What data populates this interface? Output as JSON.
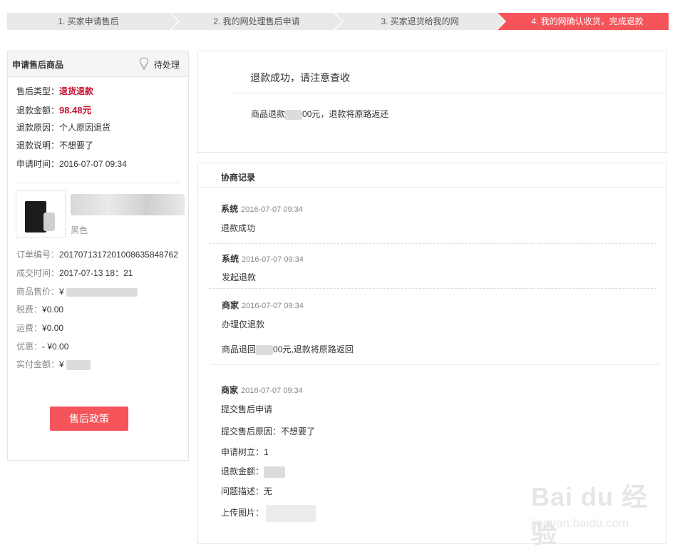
{
  "steps": [
    {
      "label": "1. 买家申请售后"
    },
    {
      "label": "2. 我的网处理售后申请"
    },
    {
      "label": "3. 买家退货给我的网"
    },
    {
      "label": "4. 我的网确认收货，完成退款"
    }
  ],
  "colors": {
    "accent": "#f4545a",
    "price_red": "#c8102e"
  },
  "left_panel": {
    "title": "申请售后商品",
    "status": "待处理",
    "status_icon": "lightbulb-icon",
    "type_label": "售后类型：",
    "type_value": "退货退款",
    "amount_label": "退款金额：",
    "amount_value": "98.48元",
    "reason_label": "退款原因：",
    "reason_value": "个人原因退货",
    "note_label": "退款说明：",
    "note_value": "不想要了",
    "apply_time_label": "申请时间：",
    "apply_time_value": "2016-07-07 09:34",
    "product_color": "黑色",
    "order_no_label": "订单编号：",
    "order_no_value": "20170713172010086358487​62",
    "deal_time_label": "成交时间：",
    "deal_time_value": "2017-07-13 18：21",
    "price_label": "商品售价：",
    "price_prefix": "¥",
    "tax_label": "税费：",
    "tax_value": "¥0.00",
    "shipping_label": "运费：",
    "shipping_value": "¥0.00",
    "discount_label": "优惠：",
    "discount_value": "- ¥0.00",
    "paid_label": "实付金额：",
    "paid_prefix": "¥",
    "button": "售后政策"
  },
  "refund_panel": {
    "title": "退款成功，请注意查收",
    "msg_prefix": "商品退款",
    "msg_suffix": "00元，退款将原路返还"
  },
  "records": {
    "title": "协商记录",
    "items": [
      {
        "who": "系统",
        "time": "2016-07-07 09:34",
        "lines": [
          "退款成功"
        ]
      },
      {
        "who": "系统",
        "time": "2016-07-07 09:34",
        "lines": [
          "发起退款"
        ]
      },
      {
        "who": "商家",
        "time": "2016-07-07 09:34",
        "lines": [
          "办理仅退款"
        ],
        "refund_prefix": "商品退回",
        "refund_suffix": "00元,退款将原路返回"
      },
      {
        "who": "商家",
        "time": "2016-07-07 09:34",
        "lines": [
          "提交售后申请",
          "提交售后原因：不想要了",
          "申请树立：1",
          "退款金额：",
          "问题描述：无",
          "上传图片："
        ]
      }
    ]
  },
  "watermark": {
    "logo": "Bai du 经验",
    "url": "jingyan.baidu.com"
  }
}
